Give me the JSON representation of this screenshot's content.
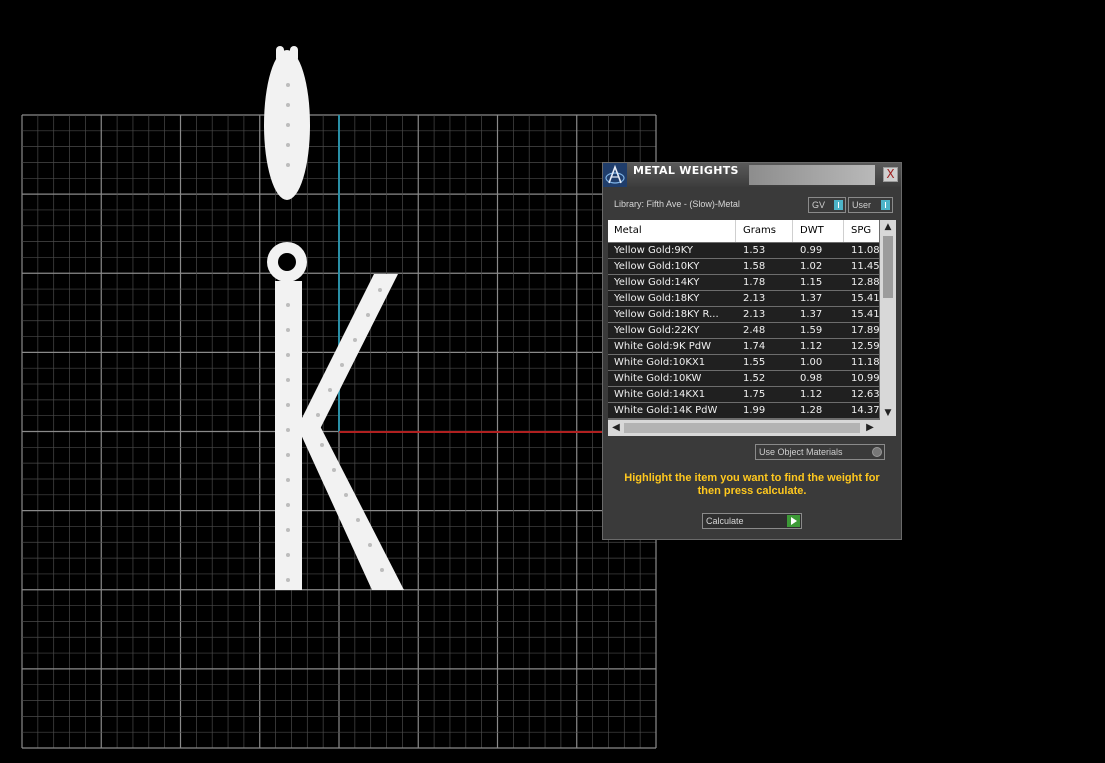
{
  "viewport": {
    "model_description": "k"
  },
  "dialog": {
    "title": "METAL WEIGHTS",
    "close_label": "X",
    "library_label": "Library: Fifth Ave - (Slow)-Metal",
    "gv_toggle": "GV",
    "user_toggle": "User",
    "columns": [
      "Metal",
      "Grams",
      "DWT",
      "SPG"
    ],
    "rows": [
      {
        "metal": "Yellow Gold:9KY",
        "grams": "1.53",
        "dwt": "0.99",
        "spg": "11.08"
      },
      {
        "metal": "Yellow Gold:10KY",
        "grams": "1.58",
        "dwt": "1.02",
        "spg": "11.45"
      },
      {
        "metal": "Yellow Gold:14KY",
        "grams": "1.78",
        "dwt": "1.15",
        "spg": "12.88"
      },
      {
        "metal": "Yellow Gold:18KY",
        "grams": "2.13",
        "dwt": "1.37",
        "spg": "15.41"
      },
      {
        "metal": "Yellow Gold:18KY R...",
        "grams": "2.13",
        "dwt": "1.37",
        "spg": "15.41"
      },
      {
        "metal": "Yellow Gold:22KY",
        "grams": "2.48",
        "dwt": "1.59",
        "spg": "17.89"
      },
      {
        "metal": "White Gold:9K PdW",
        "grams": "1.74",
        "dwt": "1.12",
        "spg": "12.59"
      },
      {
        "metal": "White Gold:10KX1",
        "grams": "1.55",
        "dwt": "1.00",
        "spg": "11.18"
      },
      {
        "metal": "White Gold:10KW",
        "grams": "1.52",
        "dwt": "0.98",
        "spg": "10.99"
      },
      {
        "metal": "White Gold:14KX1",
        "grams": "1.75",
        "dwt": "1.12",
        "spg": "12.63"
      },
      {
        "metal": "White Gold:14K PdW",
        "grams": "1.99",
        "dwt": "1.28",
        "spg": "14.37"
      }
    ],
    "use_object_materials": "Use Object Materials",
    "instructions": "Highlight the item you want to find the weight for then press calculate.",
    "calculate_label": "Calculate"
  },
  "icons": {
    "app_logo": "app-logo-icon",
    "close": "close-icon",
    "scroll_up": "chevron-up-icon",
    "scroll_down": "chevron-down-icon",
    "scroll_left": "chevron-left-icon",
    "scroll_right": "chevron-right-icon",
    "play": "play-icon"
  },
  "colors": {
    "background": "#000000",
    "grid": "#5a5a5a",
    "axis_y": "#2a8fa6",
    "axis_x": "#b02020",
    "accent_text": "#ffc81e",
    "toggle_knob": "#4db4c8",
    "calculate_play": "#3c9a36"
  }
}
